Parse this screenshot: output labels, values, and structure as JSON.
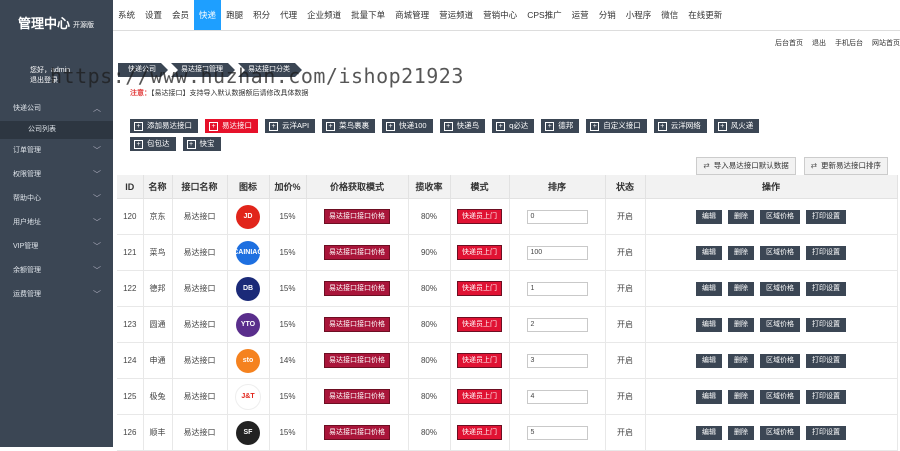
{
  "brand": {
    "title": "管理中心",
    "tag": "开源版"
  },
  "user": {
    "line1": "您好，admin",
    "line2": "退出登录"
  },
  "sidebar": {
    "items": [
      {
        "label": "快递公司",
        "open": true
      },
      {
        "label": "公司列表",
        "sub": true
      },
      {
        "label": "订单管理"
      },
      {
        "label": "权限管理"
      },
      {
        "label": "帮助中心"
      },
      {
        "label": "用户地址"
      },
      {
        "label": "VIP管理"
      },
      {
        "label": "余额管理"
      },
      {
        "label": "运费管理"
      }
    ]
  },
  "topnav": [
    "系统",
    "设置",
    "会员",
    "快递",
    "跑腿",
    "积分",
    "代理",
    "企业频道",
    "批量下单",
    "商城管理",
    "营运频道",
    "营销中心",
    "CPS推广",
    "运营",
    "分销",
    "小程序",
    "微信",
    "在线更新"
  ],
  "topnav_active": 3,
  "quick_links": [
    "后台首页",
    "退出",
    "手机后台",
    "网站首页"
  ],
  "breadcrumbs": [
    "快递公司",
    "易达接口管理",
    "易达接口分类"
  ],
  "notice": {
    "label": "注意：",
    "text": "【易达接口】支持导入默认数据额后请修改具体数据"
  },
  "buttons_row1": [
    {
      "label": "添加易达接口",
      "red": false
    },
    {
      "label": "易达接口",
      "red": true
    },
    {
      "label": "云洋API",
      "red": false
    },
    {
      "label": "菜鸟裹裹",
      "red": false
    },
    {
      "label": "快递100",
      "red": false
    },
    {
      "label": "快递鸟",
      "red": false
    },
    {
      "label": "q必达",
      "red": false
    },
    {
      "label": "德邦",
      "red": false
    },
    {
      "label": "自定义接口",
      "red": false
    },
    {
      "label": "云洋网络",
      "red": false
    },
    {
      "label": "风火递",
      "red": false
    }
  ],
  "buttons_row2": [
    {
      "label": "包包达",
      "red": false
    },
    {
      "label": "快宝",
      "red": false
    }
  ],
  "right_buttons": [
    "导入易达接口默认数据",
    "更新易达接口排序"
  ],
  "table": {
    "headers": [
      "ID",
      "名称",
      "接口名称",
      "图标",
      "加价%",
      "价格获取模式",
      "揽收率",
      "模式",
      "排序",
      "状态",
      "操作"
    ],
    "rows": [
      {
        "id": "120",
        "name": "京东",
        "api": "易达接口",
        "logo": "JD",
        "logo_color": "#e1251b",
        "markup": "15%",
        "price_mode": "易达接口接口价格",
        "pickup": "80%",
        "mode": "快递员上门",
        "sort": "0",
        "status": "开启"
      },
      {
        "id": "121",
        "name": "菜鸟",
        "api": "易达接口",
        "logo": "CAINIAO",
        "logo_color": "#1d6fe0",
        "markup": "15%",
        "price_mode": "易达接口接口价格",
        "pickup": "90%",
        "mode": "快递员上门",
        "sort": "100",
        "status": "开启"
      },
      {
        "id": "122",
        "name": "德邦",
        "api": "易达接口",
        "logo": "DB",
        "logo_color": "#1b2a78",
        "markup": "15%",
        "price_mode": "易达接口接口价格",
        "pickup": "80%",
        "mode": "快递员上门",
        "sort": "1",
        "status": "开启"
      },
      {
        "id": "123",
        "name": "圆通",
        "api": "易达接口",
        "logo": "YTO",
        "logo_color": "#5a2e8c",
        "markup": "15%",
        "price_mode": "易达接口接口价格",
        "pickup": "80%",
        "mode": "快递员上门",
        "sort": "2",
        "status": "开启"
      },
      {
        "id": "124",
        "name": "申通",
        "api": "易达接口",
        "logo": "sto",
        "logo_color": "#f5821f",
        "markup": "14%",
        "price_mode": "易达接口接口价格",
        "pickup": "80%",
        "mode": "快递员上门",
        "sort": "3",
        "status": "开启"
      },
      {
        "id": "125",
        "name": "极兔",
        "api": "易达接口",
        "logo": "J&T",
        "logo_color": "#ffffff",
        "markup": "15%",
        "price_mode": "易达接口接口价格",
        "pickup": "80%",
        "mode": "快递员上门",
        "sort": "4",
        "status": "开启"
      },
      {
        "id": "126",
        "name": "顺丰",
        "api": "易达接口",
        "logo": "SF",
        "logo_color": "#222222",
        "markup": "15%",
        "price_mode": "易达接口接口价格",
        "pickup": "80%",
        "mode": "快递员上门",
        "sort": "5",
        "status": "开启"
      }
    ],
    "actions": [
      "编辑",
      "删除",
      "区域价格",
      "打印设置"
    ]
  },
  "watermark": "https://www.huzhan.com/ishop21923",
  "colors": {
    "sidebar": "#3b4654",
    "accent": "#1e9fff",
    "danger": "#e6112a",
    "pill": "#a9153a"
  }
}
